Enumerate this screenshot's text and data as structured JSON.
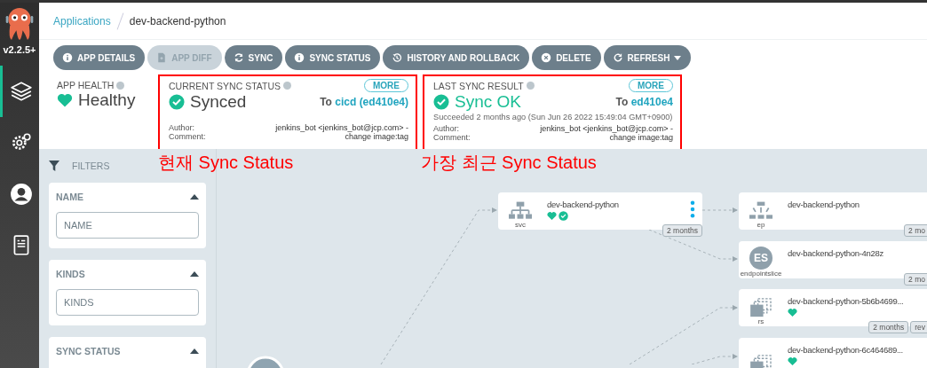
{
  "sidebar": {
    "version": "v2.2.5+",
    "nav_items": [
      {
        "kind": "apps",
        "selected": true
      },
      {
        "kind": "settings",
        "selected": false
      },
      {
        "kind": "user",
        "selected": false
      },
      {
        "kind": "docs",
        "selected": false
      }
    ]
  },
  "breadcrumb": {
    "parent": "Applications",
    "current": "dev-backend-python"
  },
  "toolbar": [
    {
      "label": "APP DETAILS",
      "kind": "info",
      "disabled": false
    },
    {
      "label": "APP DIFF",
      "kind": "file",
      "disabled": true
    },
    {
      "label": "SYNC",
      "kind": "sync",
      "disabled": false
    },
    {
      "label": "SYNC STATUS",
      "kind": "info",
      "disabled": false
    },
    {
      "label": "HISTORY AND ROLLBACK",
      "kind": "history",
      "disabled": false
    },
    {
      "label": "DELETE",
      "kind": "delete",
      "disabled": false
    },
    {
      "label": "REFRESH",
      "kind": "refresh",
      "disabled": false,
      "dropdown": true
    }
  ],
  "app_health": {
    "title": "APP HEALTH",
    "status": "Healthy"
  },
  "current_sync": {
    "title": "CURRENT SYNC STATUS",
    "more": "MORE",
    "status": "Synced",
    "to_label": "To",
    "target": "cicd (ed410e4)",
    "author_label": "Author:",
    "author": "jenkins_bot <jenkins_bot@jcp.com> -",
    "comment_label": "Comment:",
    "comment": "change image:tag",
    "annotation": "현재 Sync Status"
  },
  "last_sync": {
    "title": "LAST SYNC RESULT",
    "more": "MORE",
    "status": "Sync OK",
    "to_label": "To",
    "target": "ed410e4",
    "succeeded": "Succeeded 2 months ago (Sun Jun 26 2022 15:49:04 GMT+0900)",
    "author_label": "Author:",
    "author": "jenkins_bot <jenkins_bot@jcp.com> -",
    "comment_label": "Comment:",
    "comment": "change image:tag",
    "annotation": "가장 최근 Sync Status"
  },
  "filters": {
    "title": "FILTERS",
    "sections": [
      {
        "title": "NAME",
        "placeholder": "NAME",
        "expanded": true
      },
      {
        "title": "KINDS",
        "placeholder": "KINDS",
        "expanded": true
      },
      {
        "title": "SYNC STATUS",
        "expanded": true
      }
    ]
  },
  "graph": {
    "nodes": [
      {
        "kind": "svc",
        "kind_label": "svc",
        "name": "dev-backend-python",
        "healthy": true,
        "synced": true,
        "menu": true,
        "tags": [
          "2 months"
        ]
      },
      {
        "kind": "ep",
        "kind_label": "ep",
        "name": "dev-backend-python",
        "healthy": false,
        "synced": false,
        "menu": false,
        "tags": [
          "2 mo"
        ]
      },
      {
        "kind": "endpointslice",
        "kind_label": "endpointslice",
        "badge": "ES",
        "name": "dev-backend-python-4n28z",
        "healthy": false,
        "synced": false,
        "menu": false,
        "tags": [
          "2 mo"
        ]
      },
      {
        "kind": "rs",
        "kind_label": "rs",
        "name": "dev-backend-python-5b6b4699...",
        "healthy": true,
        "synced": false,
        "menu": false,
        "tags": [
          "2 months",
          "rev"
        ]
      },
      {
        "kind": "rs",
        "name": "dev-backend-python-6c464689...",
        "healthy": true,
        "synced": false,
        "menu": false
      }
    ]
  }
}
